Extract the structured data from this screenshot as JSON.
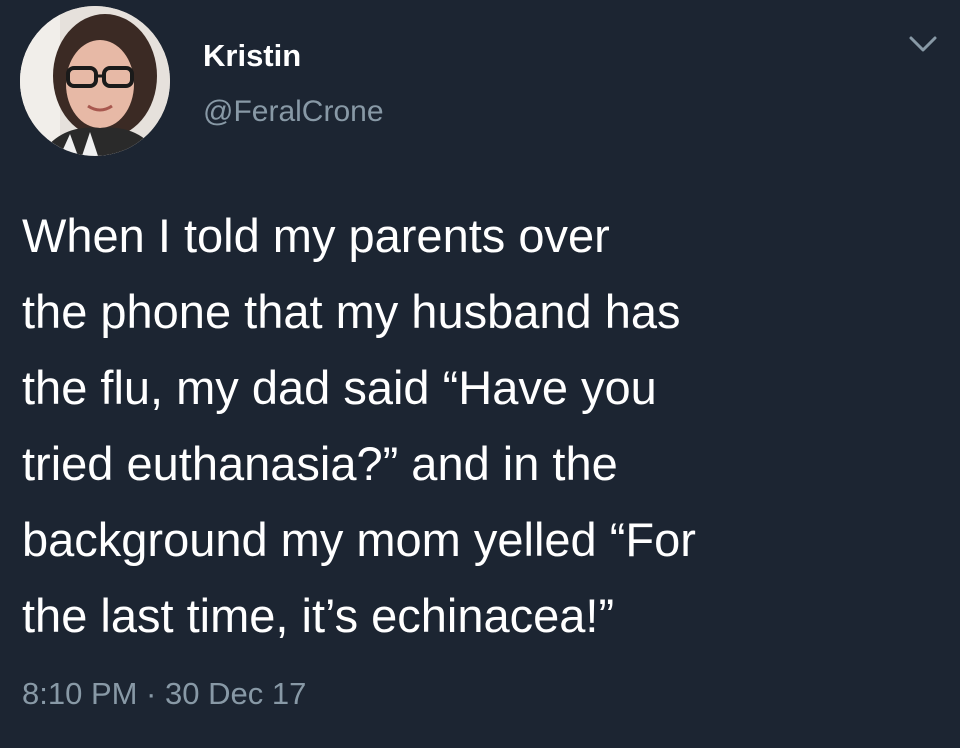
{
  "colors": {
    "background": "#1c2532",
    "text_primary": "#ffffff",
    "text_secondary": "#8899a6"
  },
  "author": {
    "display_name": "Kristin",
    "handle": "@FeralCrone",
    "avatar": "profile-photo"
  },
  "menu": {
    "icon": "chevron-down-icon"
  },
  "tweet": {
    "lines": [
      "When I told my parents over",
      "the phone that my husband has",
      "the flu, my dad said “Have you",
      "tried euthanasia?” and in the",
      "background my mom yelled “For",
      "the last time, it’s echinacea!”"
    ],
    "timestamp": "8:10 PM · 30 Dec 17"
  }
}
